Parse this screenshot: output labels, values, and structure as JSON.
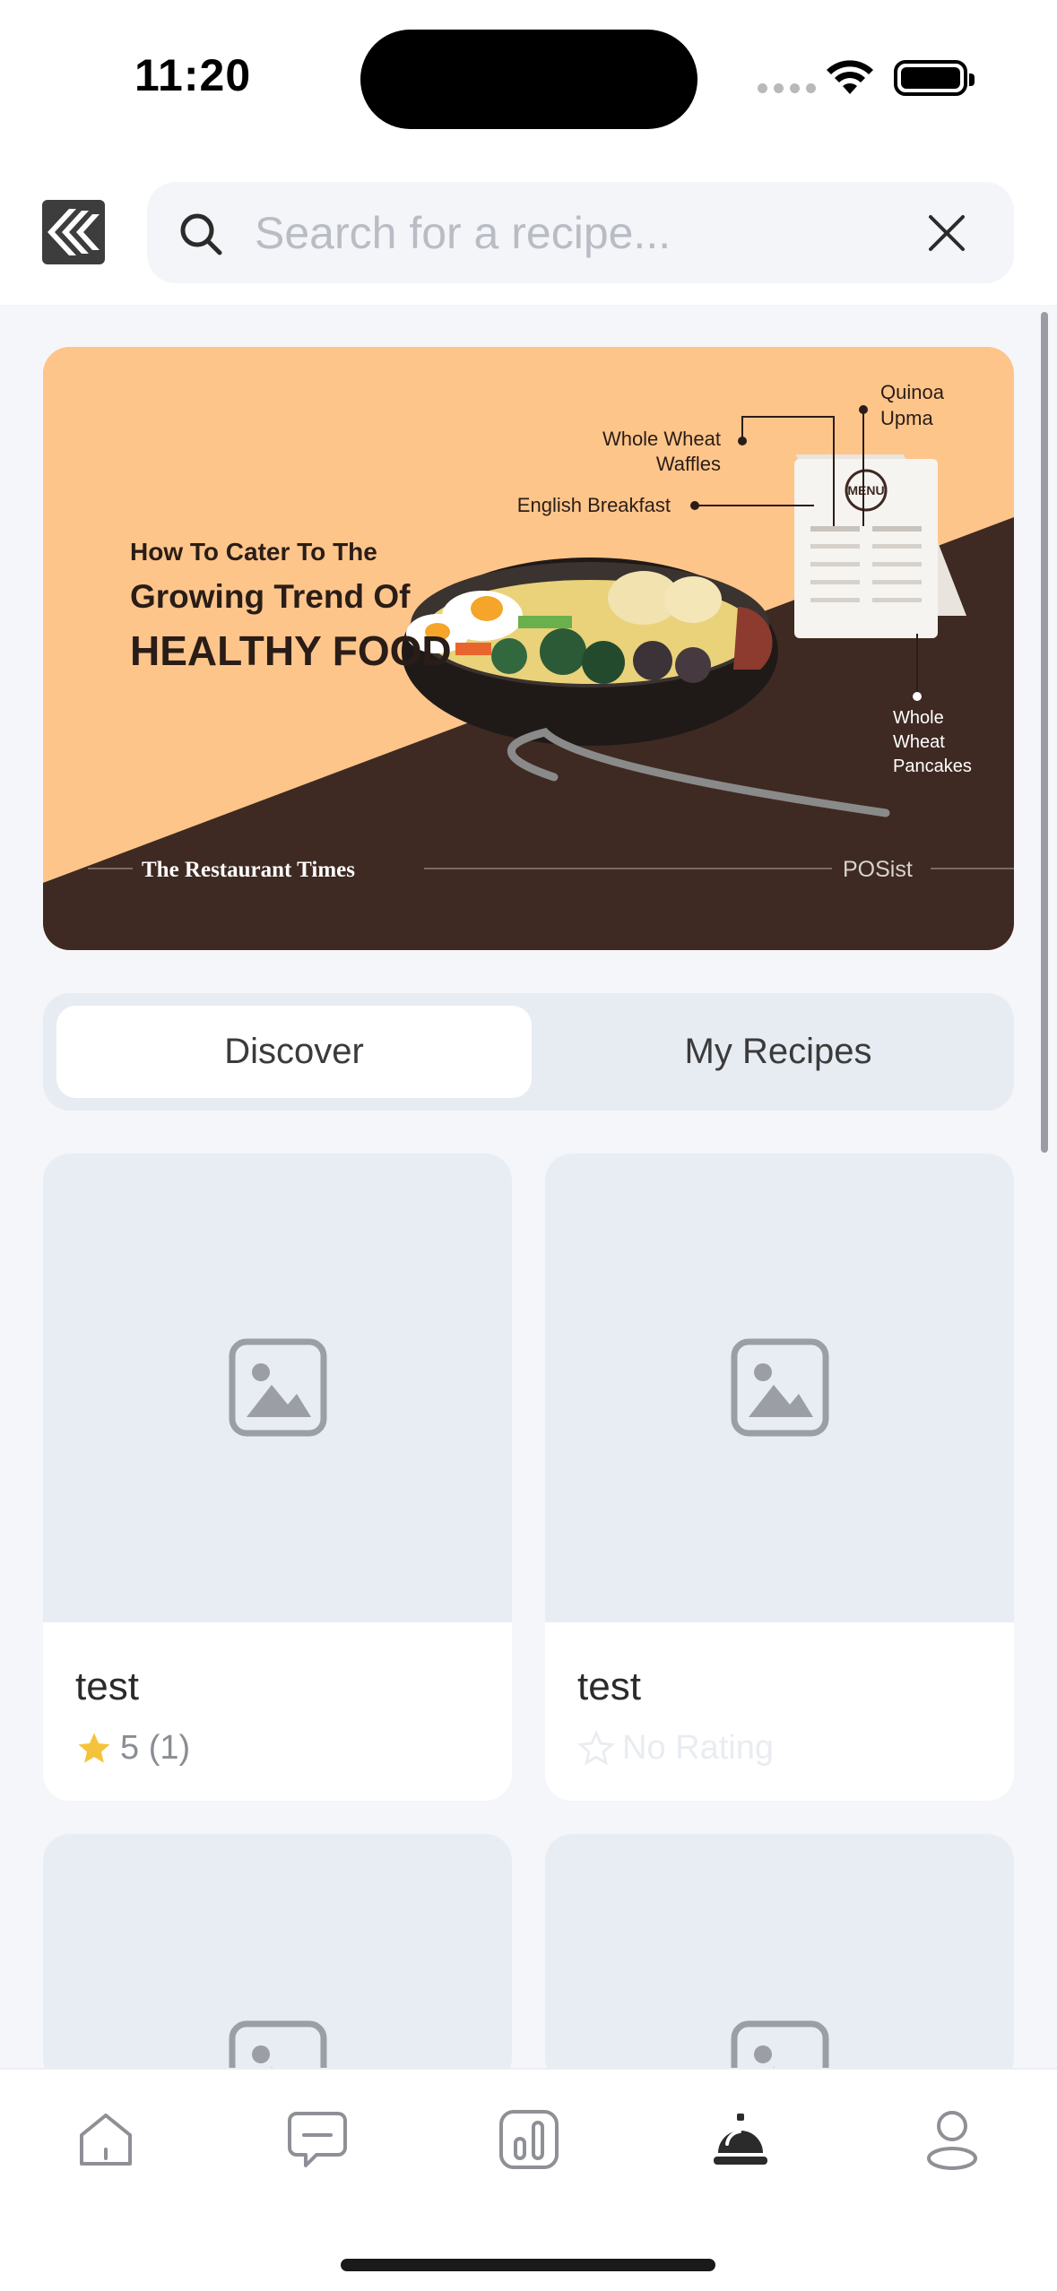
{
  "status_bar": {
    "time": "11:20"
  },
  "search": {
    "placeholder": "Search for a recipe..."
  },
  "banner": {
    "headline_line1": "How To Cater To The",
    "headline_line2": "Growing Trend Of",
    "headline_line3": "HEALTHY FOOD",
    "callout_1": "Quinoa",
    "callout_1b": "Upma",
    "callout_2": "Whole Wheat",
    "callout_2b": "Waffles",
    "callout_3": "English Breakfast",
    "callout_4": "Whole",
    "callout_4b": "Wheat",
    "callout_4c": "Pancakes",
    "menu_sign": "MENU",
    "publisher": "The Restaurant Times",
    "brand": "POSist"
  },
  "tabs": [
    {
      "label": "Discover",
      "active": true
    },
    {
      "label": "My Recipes",
      "active": false
    }
  ],
  "recipes": [
    {
      "title": "test",
      "rating": "5 (1)",
      "rated": true
    },
    {
      "title": "test",
      "rating": "No Rating",
      "rated": false
    },
    {
      "title": "",
      "rating": "",
      "rated": false
    },
    {
      "title": "",
      "rating": "",
      "rated": false
    }
  ],
  "bottom_nav": [
    "home-icon",
    "chat-icon",
    "chart-icon",
    "service-bell-icon",
    "profile-icon"
  ],
  "colors": {
    "accent_star": "#f5c33b",
    "banner_bg": "#fec58a",
    "banner_dark": "#3e2a22"
  }
}
